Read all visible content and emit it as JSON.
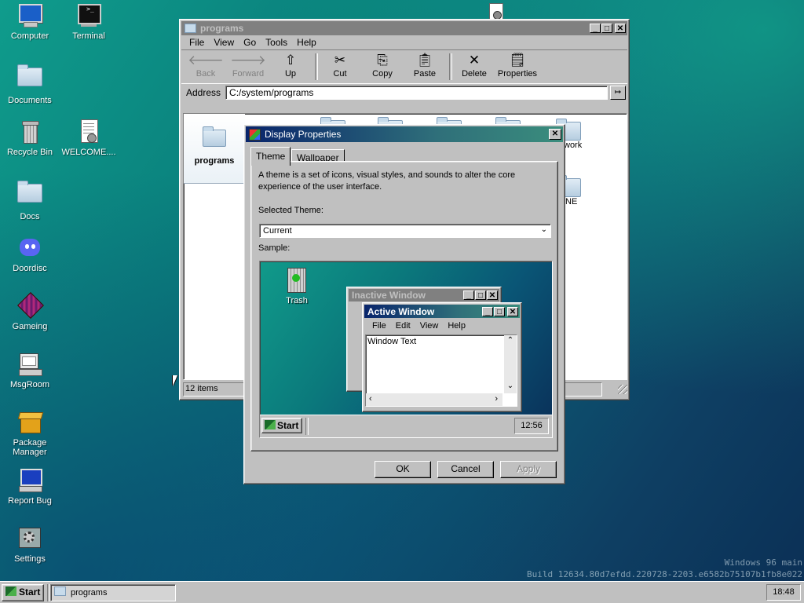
{
  "desktop": {
    "icons": [
      {
        "label": "Computer"
      },
      {
        "label": "Terminal"
      },
      {
        "label": "Documents"
      },
      {
        "label": "Recycle Bin"
      },
      {
        "label": "WELCOME...."
      },
      {
        "label": "Docs"
      },
      {
        "label": "Doordisc"
      },
      {
        "label": "Gameing"
      },
      {
        "label": "MsgRoom"
      },
      {
        "label": "Package Manager"
      },
      {
        "label": "Report Bug"
      },
      {
        "label": "Settings"
      }
    ],
    "watermark": {
      "line1": "Windows 96 main",
      "line2": "Build 12634.80d7efdd.220728-2203.e6582b75107b1fb8e022"
    }
  },
  "explorer": {
    "title": "programs",
    "menu": [
      "File",
      "View",
      "Go",
      "Tools",
      "Help"
    ],
    "toolbar": {
      "back": "Back",
      "forward": "Forward",
      "up": "Up",
      "cut": "Cut",
      "copy": "Copy",
      "paste": "Paste",
      "delete": "Delete",
      "properties": "Properties"
    },
    "address_label": "Address",
    "address_value": "C:/system/programs",
    "sidebar_title": "programs",
    "partial_labels": [
      "work",
      "NE"
    ],
    "status": "12 items"
  },
  "dialog": {
    "title": "Display Properties",
    "tabs": [
      "Theme",
      "Wallpaper"
    ],
    "description": "A theme is a set of icons, visual styles, and sounds to alter the core experience of the user interface.",
    "selected_theme_label": "Selected Theme:",
    "selected_theme_value": "Current",
    "sample_label": "Sample:",
    "sample": {
      "trash_label": "Trash",
      "inactive_title": "Inactive Window",
      "active_title": "Active Window",
      "menu": [
        "File",
        "Edit",
        "View",
        "Help"
      ],
      "window_text": "Window Text",
      "start": "Start",
      "clock": "12:56"
    },
    "buttons": {
      "ok": "OK",
      "cancel": "Cancel",
      "apply": "Apply"
    }
  },
  "taskbar": {
    "start": "Start",
    "tasks": [
      {
        "label": "programs"
      }
    ],
    "clock": "18:48"
  },
  "colors": {
    "accent_titlebar": "#08246b",
    "face": "#c0c0c0"
  }
}
